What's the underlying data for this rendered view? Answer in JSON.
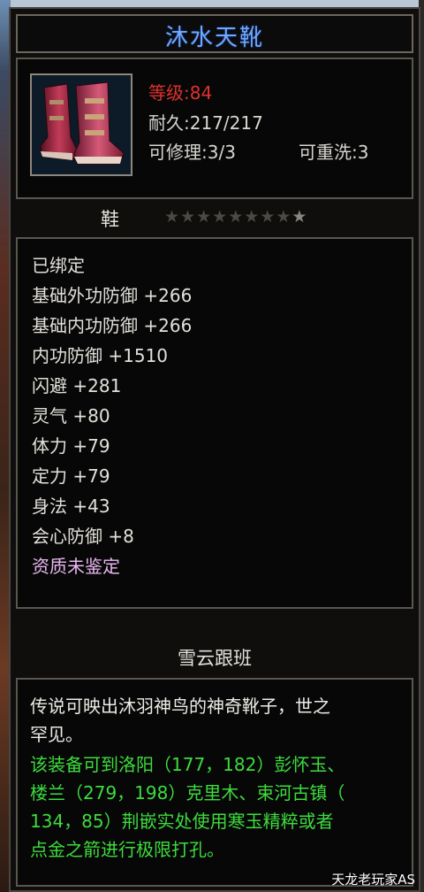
{
  "item": {
    "name": "沐水天靴",
    "level": "等级:84",
    "durability": "耐久:217/217",
    "repairable": "可修理:3/3",
    "rewashable": "可重洗:3"
  },
  "type": {
    "label": "鞋",
    "stars_total": 9,
    "stars_lit": 1
  },
  "attributes": [
    "已绑定",
    "基础外功防御 +266",
    "基础内功防御 +266",
    "内功防御 +1510",
    "闪避 +281",
    "灵气 +80",
    "体力 +79",
    "定力 +79",
    "身法 +43",
    "会心防御 +8",
    "资质未鉴定"
  ],
  "set_name": "雪云跟班",
  "description": {
    "lines_white": [
      "传说可映出沐羽神鸟的神奇靴子，世之",
      "罕见。"
    ],
    "lines_green": [
      "该装备可到洛阳（177，182）彭怀玉、",
      "楼兰（279，198）克里木、束河古镇（",
      "134，85）荆嵌实处使用寒玉精粹或者",
      "点金之箭进行极限打孔。"
    ]
  },
  "watermark": "天龙老玩家AS",
  "colors": {
    "title": "#6ea8ff",
    "level": "#e0322d",
    "unidentified": "#e8b8f0",
    "green_text": "#3ddc3d"
  }
}
